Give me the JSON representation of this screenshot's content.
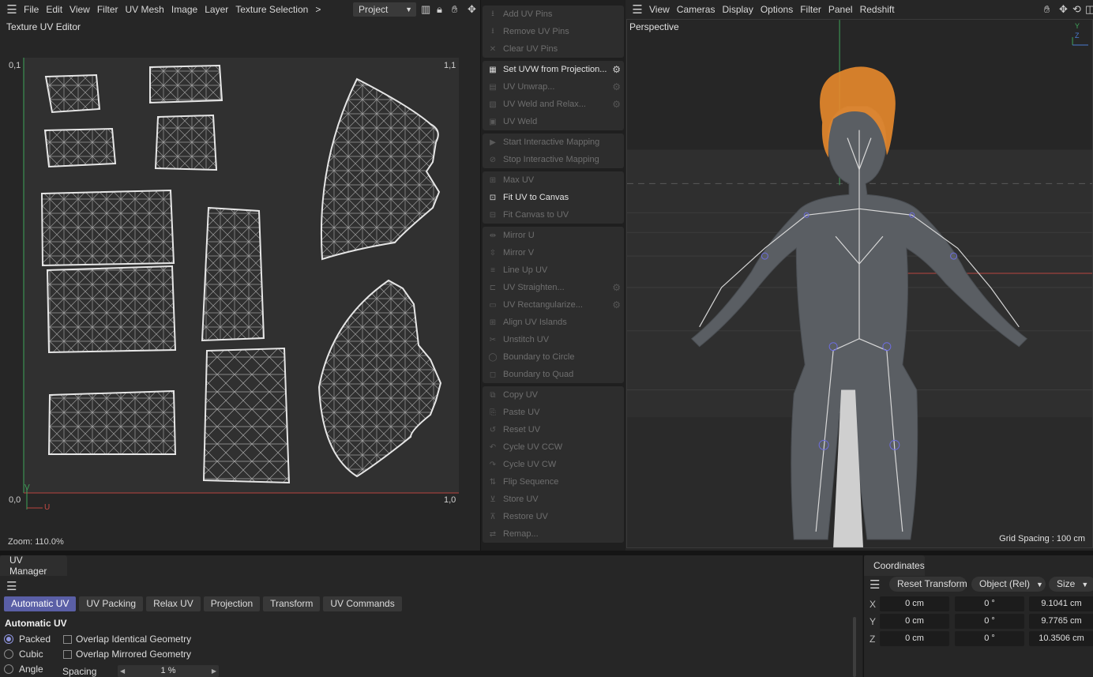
{
  "uv_editor": {
    "menu": [
      "File",
      "Edit",
      "View",
      "Filter",
      "UV Mesh",
      "Image",
      "Layer",
      "Texture Selection",
      ">"
    ],
    "project_select": "Project",
    "title": "Texture UV Editor",
    "corners": {
      "top_left": "0,1",
      "top_right": "1,1",
      "bottom_left": "0,0",
      "bottom_right": "1,0"
    },
    "axis_v": "V",
    "axis_u": "U",
    "zoom": "Zoom: 110.0%"
  },
  "commands": {
    "groups": [
      [
        {
          "label": "Add UV Pins",
          "enabled": false,
          "icon": "pin-icon"
        },
        {
          "label": "Remove UV Pins",
          "enabled": false,
          "icon": "pin-icon"
        },
        {
          "label": "Clear UV Pins",
          "enabled": false,
          "icon": "close-icon"
        }
      ],
      [
        {
          "label": "Set UVW from Projection...",
          "enabled": true,
          "icon": "checker-icon",
          "gear": true
        },
        {
          "label": "UV Unwrap...",
          "enabled": false,
          "icon": "unwrap-icon",
          "gear": true
        },
        {
          "label": "UV Weld and Relax...",
          "enabled": false,
          "icon": "weld-relax-icon",
          "gear": true
        },
        {
          "label": "UV Weld",
          "enabled": false,
          "icon": "weld-icon"
        }
      ],
      [
        {
          "label": "Start Interactive Mapping",
          "enabled": false,
          "icon": "play-icon"
        },
        {
          "label": "Stop Interactive Mapping",
          "enabled": false,
          "icon": "stop-icon"
        }
      ],
      [
        {
          "label": "Max UV",
          "enabled": false,
          "icon": "max-uv-icon"
        },
        {
          "label": "Fit UV to Canvas",
          "enabled": true,
          "icon": "fit-icon"
        },
        {
          "label": "Fit Canvas to UV",
          "enabled": false,
          "icon": "fit-canvas-icon"
        }
      ],
      [
        {
          "label": "Mirror U",
          "enabled": false,
          "icon": "mirror-u-icon"
        },
        {
          "label": "Mirror V",
          "enabled": false,
          "icon": "mirror-v-icon"
        },
        {
          "label": "Line Up UV",
          "enabled": false,
          "icon": "line-up-icon"
        },
        {
          "label": "UV Straighten...",
          "enabled": false,
          "icon": "straighten-icon",
          "gear": true
        },
        {
          "label": "UV Rectangularize...",
          "enabled": false,
          "icon": "rectangularize-icon",
          "gear": true
        },
        {
          "label": "Align UV Islands",
          "enabled": false,
          "icon": "align-icon"
        },
        {
          "label": "Unstitch UV",
          "enabled": false,
          "icon": "unstitch-icon"
        },
        {
          "label": "Boundary to Circle",
          "enabled": false,
          "icon": "circle-icon"
        },
        {
          "label": "Boundary to Quad",
          "enabled": false,
          "icon": "quad-icon"
        }
      ],
      [
        {
          "label": "Copy UV",
          "enabled": false,
          "icon": "copy-icon"
        },
        {
          "label": "Paste UV",
          "enabled": false,
          "icon": "paste-icon"
        },
        {
          "label": "Reset UV",
          "enabled": false,
          "icon": "reset-icon"
        },
        {
          "label": "Cycle UV CCW",
          "enabled": false,
          "icon": "cycle-ccw-icon"
        },
        {
          "label": "Cycle UV CW",
          "enabled": false,
          "icon": "cycle-cw-icon"
        },
        {
          "label": "Flip Sequence",
          "enabled": false,
          "icon": "flip-icon"
        },
        {
          "label": "Store UV",
          "enabled": false,
          "icon": "store-icon"
        },
        {
          "label": "Restore UV",
          "enabled": false,
          "icon": "restore-icon"
        },
        {
          "label": "Remap...",
          "enabled": false,
          "icon": "remap-icon"
        }
      ]
    ]
  },
  "viewport": {
    "menu": [
      "View",
      "Cameras",
      "Display",
      "Options",
      "Filter",
      "Panel",
      "Redshift"
    ],
    "camera_label": "Perspective",
    "grid_spacing": "Grid Spacing : 100 cm",
    "axis_y": "Y",
    "axis_z": "Z",
    "hair_color": "#e88a2c"
  },
  "uv_manager": {
    "tab": "UV Manager",
    "subtabs": [
      "Automatic UV",
      "UV Packing",
      "Relax UV",
      "Projection",
      "Transform",
      "UV Commands"
    ],
    "active_subtab": "Automatic UV",
    "section_title": "Automatic UV",
    "radios": [
      {
        "label": "Packed",
        "checked": true
      },
      {
        "label": "Cubic",
        "checked": false
      },
      {
        "label": "Angle",
        "checked": false
      }
    ],
    "checkboxes": [
      {
        "label": "Overlap Identical Geometry",
        "checked": false
      },
      {
        "label": "Overlap Mirrored Geometry",
        "checked": false
      }
    ],
    "spacing_label": "Spacing",
    "spacing_value": "1 %",
    "accent": "#5a5fa6"
  },
  "coordinates": {
    "tab": "Coordinates",
    "reset_button": "Reset Transform",
    "mode_select": "Object (Rel)",
    "size_select": "Size",
    "rows": [
      {
        "axis": "X",
        "position": "0 cm",
        "rotation": "0 °",
        "size": "9.1041 cm"
      },
      {
        "axis": "Y",
        "position": "0 cm",
        "rotation": "0 °",
        "size": "9.7765 cm"
      },
      {
        "axis": "Z",
        "position": "0 cm",
        "rotation": "0 °",
        "size": "10.3506 cm"
      }
    ]
  }
}
